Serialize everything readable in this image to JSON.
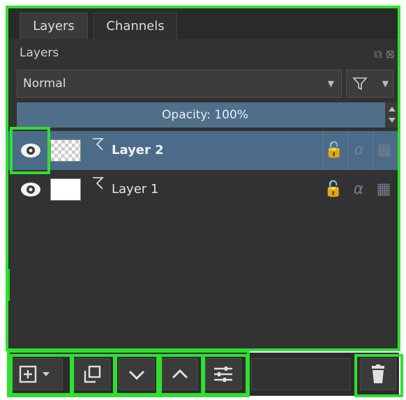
{
  "tabs": [
    {
      "label": "Layers",
      "active": true
    },
    {
      "label": "Channels",
      "active": false
    }
  ],
  "panel_title": "Layers",
  "blend_mode": "Normal",
  "opacity": {
    "label": "Opacity:",
    "value": "100%"
  },
  "layers": [
    {
      "name": "Layer 2",
      "visible": true,
      "selected": true,
      "thumbnail": "transparent"
    },
    {
      "name": "Layer 1",
      "visible": true,
      "selected": false,
      "thumbnail": "white"
    }
  ],
  "colors": {
    "panel_bg": "#323232",
    "selection": "#4b6b88",
    "highlight": "#2fe02f",
    "text": "#e6e6e6"
  },
  "toolbar": {
    "buttons": [
      {
        "icon": "add-layer-icon"
      },
      {
        "icon": "duplicate-layer-icon"
      },
      {
        "icon": "move-layer-down-icon"
      },
      {
        "icon": "move-layer-up-icon"
      },
      {
        "icon": "layer-properties-icon"
      },
      {
        "icon": "delete-layer-icon"
      }
    ]
  }
}
